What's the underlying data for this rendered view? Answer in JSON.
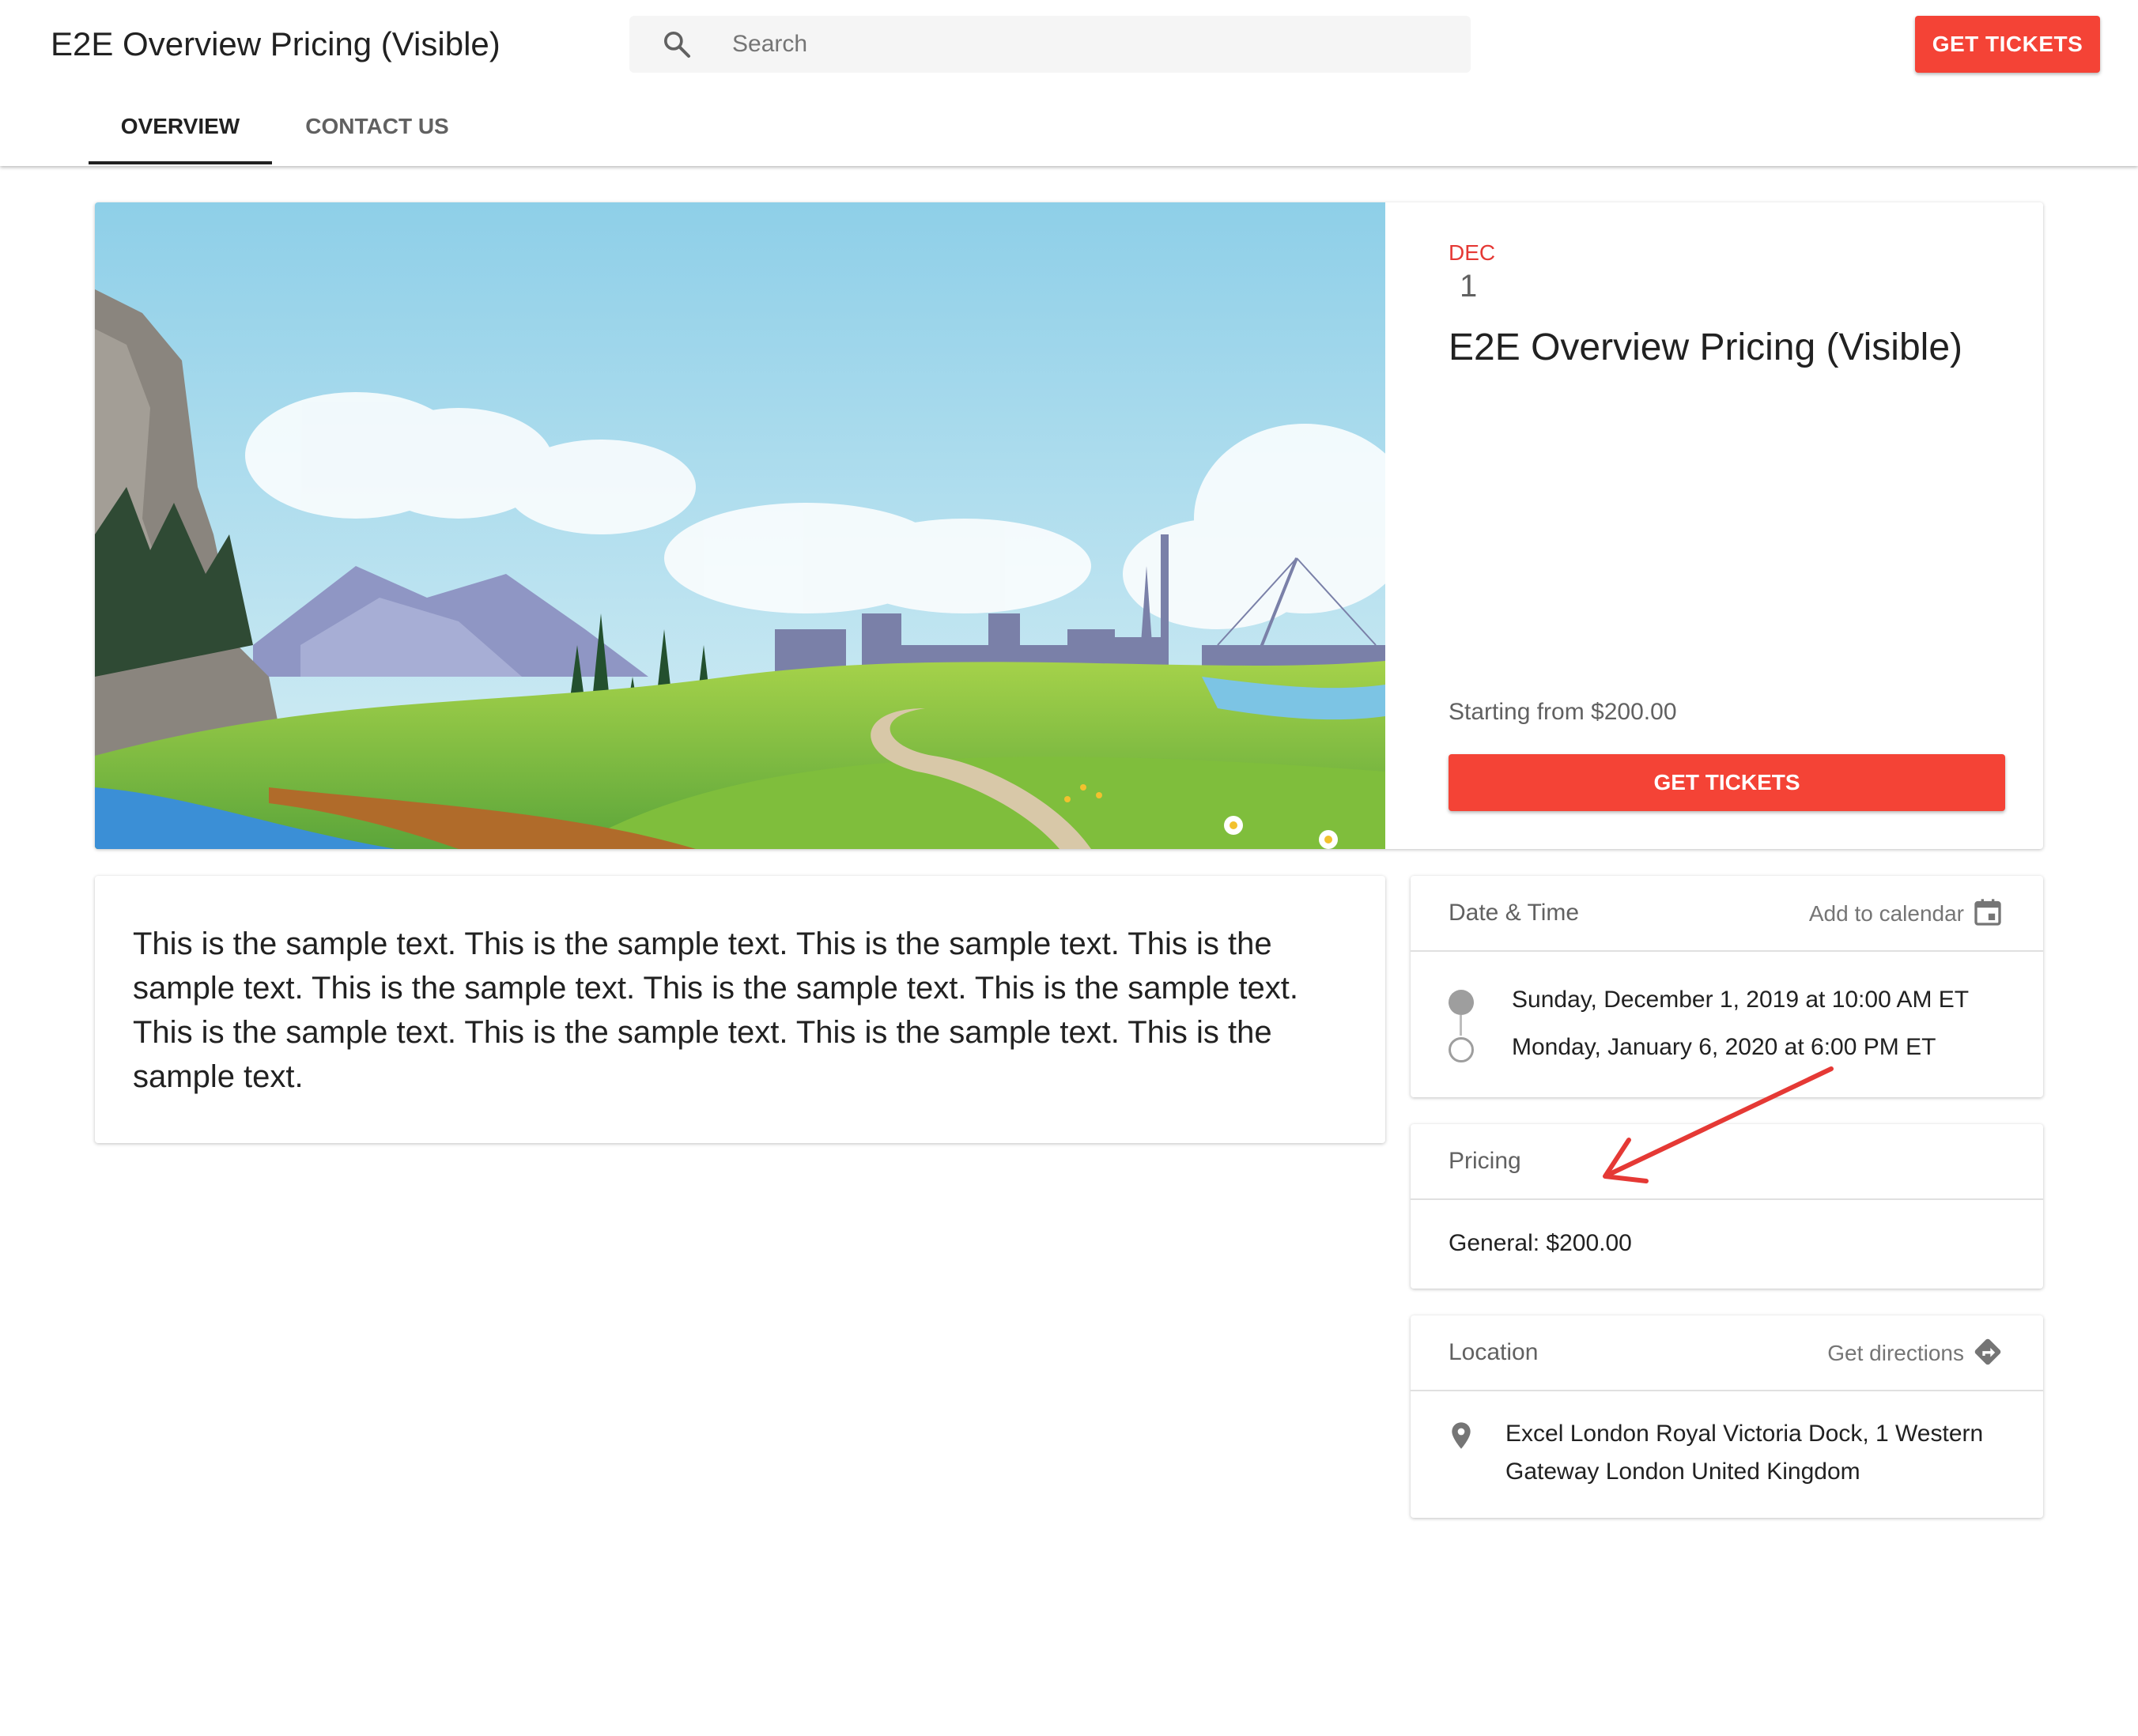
{
  "header": {
    "title": "E2E Overview Pricing (Visible)",
    "search_placeholder": "Search",
    "get_tickets_label": "GET TICKETS"
  },
  "tabs": [
    {
      "label": "OVERVIEW",
      "active": true
    },
    {
      "label": "CONTACT US",
      "active": false
    }
  ],
  "event": {
    "month": "DEC",
    "day": "1",
    "title": "E2E Overview Pricing (Visible)",
    "starting_from": "Starting from $200.00",
    "get_tickets_label": "GET TICKETS"
  },
  "description": "This is the sample text. This is the sample text. This is the sample text. This is the sample text. This is the sample text. This is the sample text. This is the sample text. This is the sample text. This is the sample text. This is the sample text. This is the sample text.",
  "datetime": {
    "label": "Date & Time",
    "action": "Add to calendar",
    "start": "Sunday, December 1, 2019 at 10:00 AM ET",
    "end": "Monday, January 6, 2020 at 6:00 PM ET"
  },
  "pricing": {
    "label": "Pricing",
    "items": [
      "General: $200.00"
    ]
  },
  "location": {
    "label": "Location",
    "action": "Get directions",
    "address": "Excel London Royal Victoria Dock, 1 Western Gateway London United Kingdom"
  },
  "colors": {
    "accent": "#f44336",
    "annotation": "#e53935"
  },
  "icons": [
    "search-icon",
    "calendar-icon",
    "directions-icon",
    "location-pin-icon"
  ]
}
